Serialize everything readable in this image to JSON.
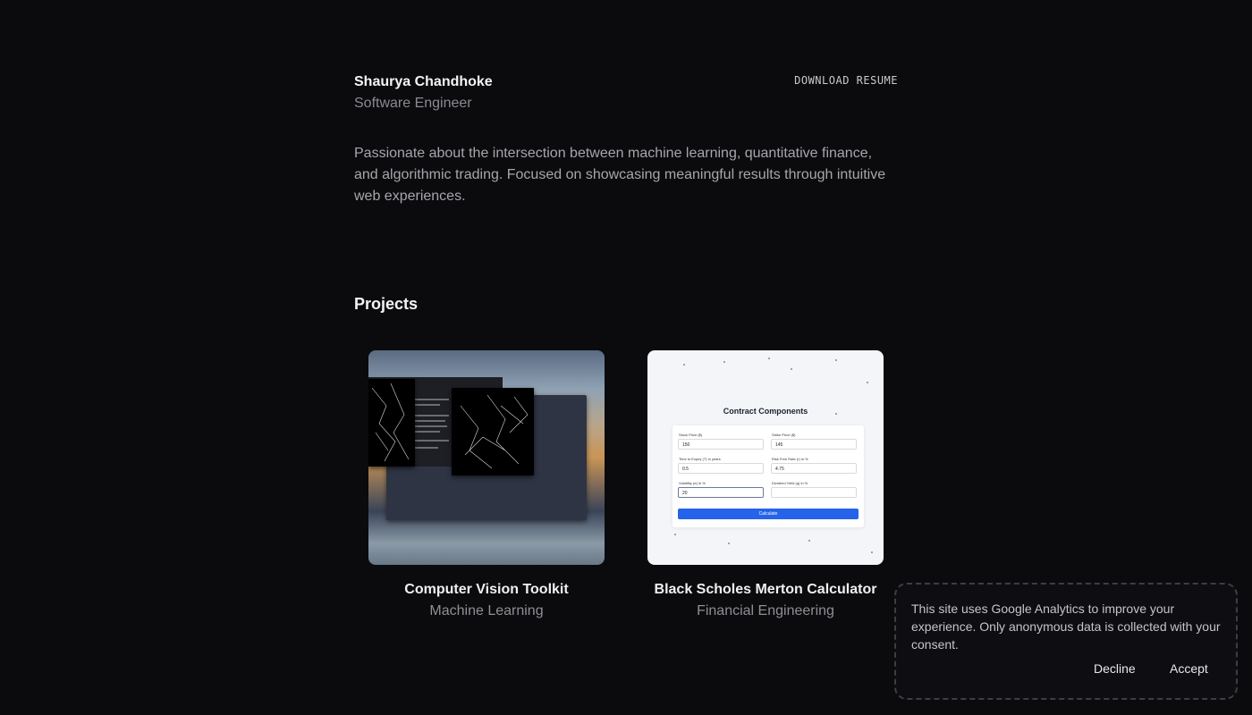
{
  "header": {
    "name": "Shaurya Chandhoke",
    "role": "Software Engineer",
    "resume_label": "DOWNLOAD RESUME"
  },
  "bio": "Passionate about the intersection between machine learning, quantitative finance, and algorithmic trading. Focused on showcasing meaningful results through intuitive web experiences.",
  "projects": {
    "title": "Projects",
    "items": [
      {
        "title": "Computer Vision Toolkit",
        "category": "Machine Learning"
      },
      {
        "title": "Black Scholes Merton Calculator",
        "category": "Financial Engineering",
        "preview": {
          "heading": "Contract Components",
          "fields": [
            {
              "label": "Stock Price ($)",
              "value": "150"
            },
            {
              "label": "Strike Price ($)",
              "value": "145"
            },
            {
              "label": "Time to Expiry (T) in years",
              "value": "0.5"
            },
            {
              "label": "Risk Free Rate (r) in %",
              "value": "4.75"
            },
            {
              "label": "Volatility (σ) in %",
              "value": "20"
            },
            {
              "label": "Dividend Yield (q) in %",
              "value": ""
            }
          ],
          "button": "Calculate"
        }
      }
    ]
  },
  "cookie": {
    "message": "This site uses Google Analytics to improve your experience. Only anonymous data is collected with your consent.",
    "decline_label": "Decline",
    "accept_label": "Accept"
  }
}
